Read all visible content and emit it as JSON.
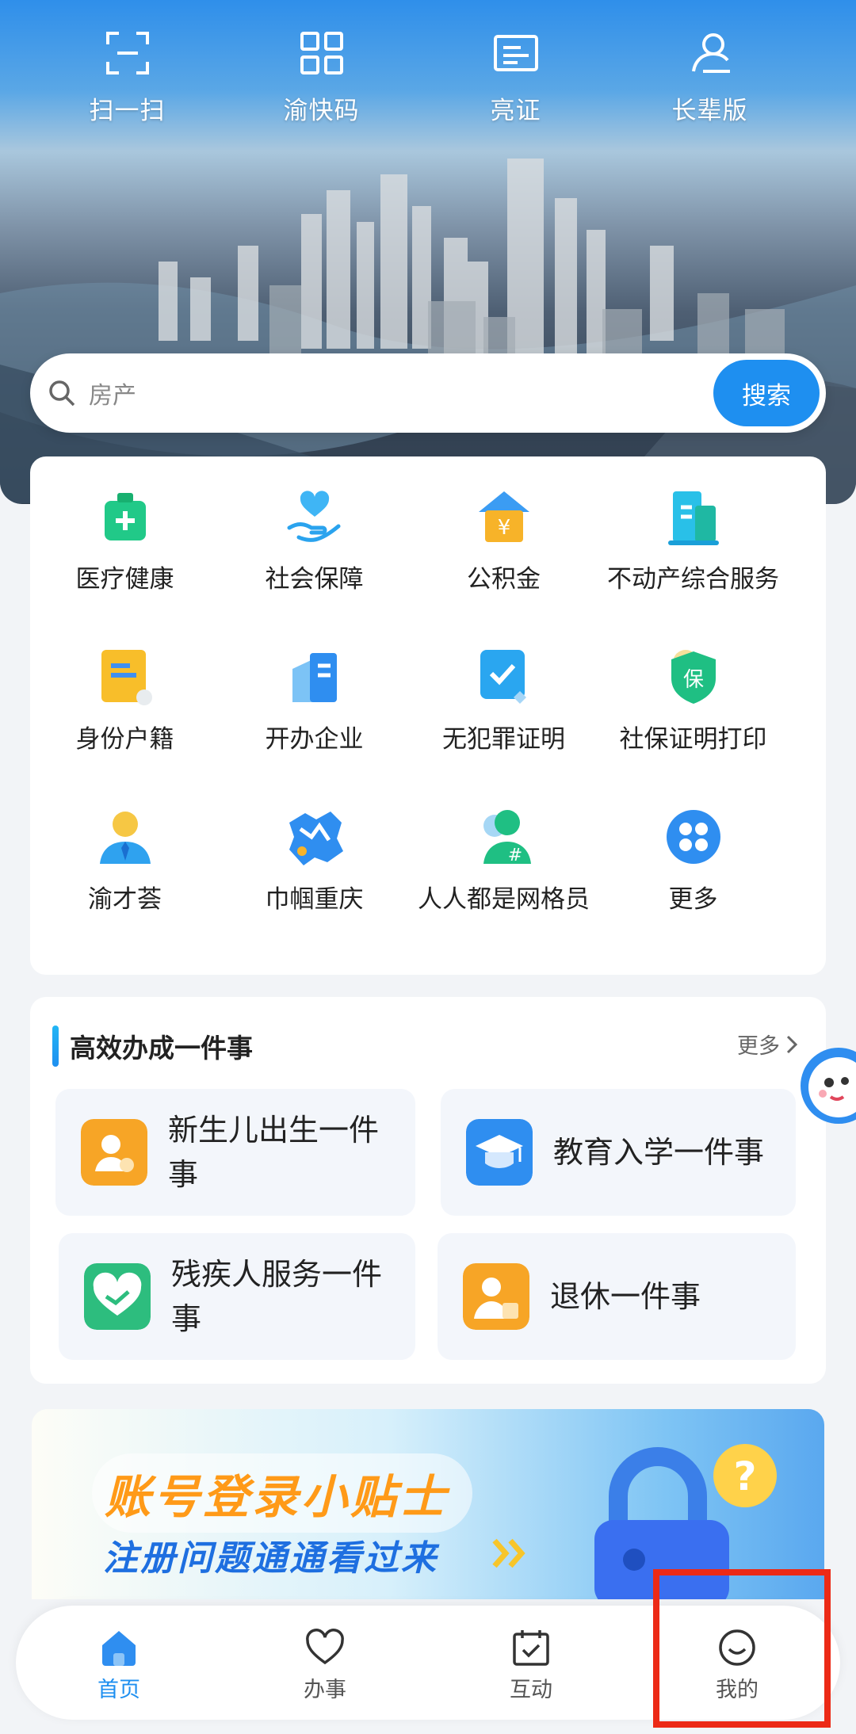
{
  "top_actions": [
    {
      "label": "扫一扫",
      "icon": "scan-icon"
    },
    {
      "label": "渝快码",
      "icon": "qr-code-icon"
    },
    {
      "label": "亮证",
      "icon": "id-card-icon"
    },
    {
      "label": "长辈版",
      "icon": "elder-mode-icon"
    }
  ],
  "search": {
    "placeholder": "房产",
    "button": "搜索"
  },
  "services": [
    {
      "label": "医疗健康",
      "icon": "medical-kit-icon"
    },
    {
      "label": "社会保障",
      "icon": "heart-hand-icon"
    },
    {
      "label": "公积金",
      "icon": "housing-fund-icon"
    },
    {
      "label": "不动产综合服务",
      "icon": "building-icon"
    },
    {
      "label": "身份户籍",
      "icon": "identity-doc-icon"
    },
    {
      "label": "开办企业",
      "icon": "company-icon"
    },
    {
      "label": "无犯罪证明",
      "icon": "certificate-check-icon"
    },
    {
      "label": "社保证明打印",
      "icon": "insurance-badge-icon"
    },
    {
      "label": "渝才荟",
      "icon": "talent-person-icon"
    },
    {
      "label": "巾帼重庆",
      "icon": "chongqing-map-icon"
    },
    {
      "label": "人人都是网格员",
      "icon": "grid-member-icon"
    },
    {
      "label": "更多",
      "icon": "more-apps-icon"
    }
  ],
  "one_thing": {
    "title": "高效办成一件事",
    "more": "更多",
    "items": [
      {
        "label": "新生儿出生一件事",
        "icon": "newborn-icon",
        "color": "#f7a526"
      },
      {
        "label": "教育入学一件事",
        "icon": "graduation-cap-icon",
        "color": "#2f8ef0"
      },
      {
        "label": "残疾人服务一件事",
        "icon": "care-heart-icon",
        "color": "#2dbd7e"
      },
      {
        "label": "退休一件事",
        "icon": "retiree-icon",
        "color": "#f7a526"
      }
    ]
  },
  "banner": {
    "title": "账号登录小贴士",
    "subtitle": "注册问题通通看过来"
  },
  "nav": [
    {
      "label": "首页",
      "icon": "home-icon",
      "active": true
    },
    {
      "label": "办事",
      "icon": "heart-outline-icon",
      "active": false
    },
    {
      "label": "互动",
      "icon": "calendar-check-icon",
      "active": false
    },
    {
      "label": "我的",
      "icon": "smile-face-icon",
      "active": false
    }
  ],
  "colors": {
    "accent": "#1e8ff0",
    "highlight": "#ec2a16"
  }
}
